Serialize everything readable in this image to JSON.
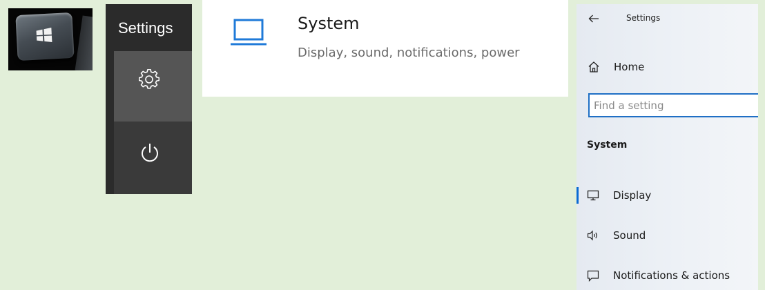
{
  "colors": {
    "background": "#e2efd9",
    "start_menu_bg": "#2b2b2b",
    "accent": "#1f6fc5",
    "settings_panel_bg": "#edf1f6"
  },
  "winkey": {
    "icon": "windows-logo-icon"
  },
  "start_menu": {
    "title": "Settings",
    "settings_icon": "gear-icon",
    "power_icon": "power-icon"
  },
  "system_tile": {
    "icon": "laptop-icon",
    "title": "System",
    "description": "Display, sound, notifications, power"
  },
  "settings_panel": {
    "back_icon": "back-arrow-icon",
    "title": "Settings",
    "home": {
      "icon": "home-icon",
      "label": "Home"
    },
    "search": {
      "placeholder": "Find a setting",
      "value": ""
    },
    "section_title": "System",
    "nav_items": [
      {
        "icon": "monitor-icon",
        "label": "Display",
        "active": true
      },
      {
        "icon": "speaker-icon",
        "label": "Sound",
        "active": false
      },
      {
        "icon": "notification-icon",
        "label": "Notifications & actions",
        "active": false
      }
    ]
  }
}
